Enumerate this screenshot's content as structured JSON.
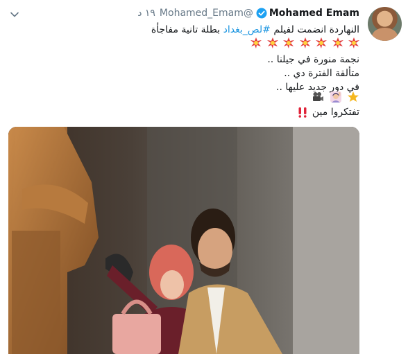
{
  "tweet": {
    "author_name": "Mohamed Emam",
    "handle": "@Mohamed_Emam",
    "time": "١٩ د",
    "line1_before": "النهاردة انضمت لفيلم",
    "hashtag": "#لص_بغداد",
    "line1_after": "بطلة تانية مفاجأة",
    "line3": "نجمة منورة في جيلنا ..",
    "line4": "متألقة الفترة دي ..",
    "line5": "في دور جديد عليها ..",
    "line7": "تفتكروا مين",
    "icons": [
      "verified-badge-icon",
      "chevron-down-icon",
      "collision-emoji-icon",
      "star-emoji-icon",
      "woman-raising-hand-emoji-icon",
      "movie-camera-emoji-icon",
      "double-exclamation-emoji-icon"
    ],
    "colors": {
      "link": "#1b95e0",
      "secondary": "#657786",
      "text": "#14171a"
    }
  }
}
